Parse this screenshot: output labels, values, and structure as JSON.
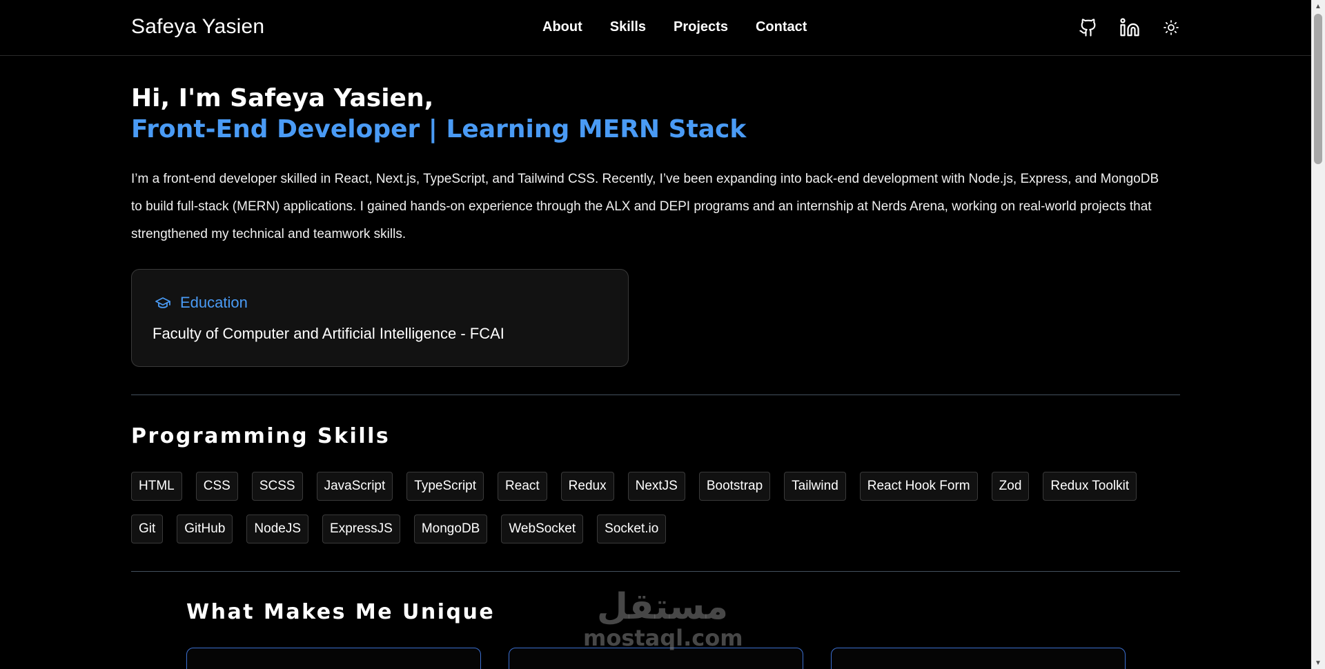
{
  "header": {
    "brand": "Safeya Yasien",
    "nav": [
      "About",
      "Skills",
      "Projects",
      "Contact"
    ],
    "icons": [
      "github-icon",
      "linkedin-icon",
      "sun-icon"
    ]
  },
  "hero": {
    "greeting": "Hi, I'm Safeya Yasien,",
    "role": "Front-End Developer | Learning MERN Stack",
    "bio": "I’m a front-end developer skilled in React, Next.js, TypeScript, and Tailwind CSS. Recently, I’ve been expanding into back-end development with Node.js, Express, and MongoDB to build full-stack (MERN) applications. I gained hands-on experience through the ALX and DEPI programs and an internship at Nerds Arena, working on real-world projects that strengthened my technical and teamwork skills."
  },
  "education": {
    "title": "Education",
    "body": "Faculty of Computer and Artificial Intelligence - FCAI"
  },
  "skills": {
    "title": "Programming Skills",
    "items": [
      "HTML",
      "CSS",
      "SCSS",
      "JavaScript",
      "TypeScript",
      "React",
      "Redux",
      "NextJS",
      "Bootstrap",
      "Tailwind",
      "React Hook Form",
      "Zod",
      "Redux Toolkit",
      "Git",
      "GitHub",
      "NodeJS",
      "ExpressJS",
      "MongoDB",
      "WebSocket",
      "Socket.io"
    ]
  },
  "unique": {
    "title": "What Makes Me Unique"
  },
  "watermark": {
    "arabic": "مستقل",
    "latin": "mostaql.com"
  },
  "colors": {
    "accent": "#4a9bf5",
    "background": "#000000",
    "card": "#121212"
  }
}
